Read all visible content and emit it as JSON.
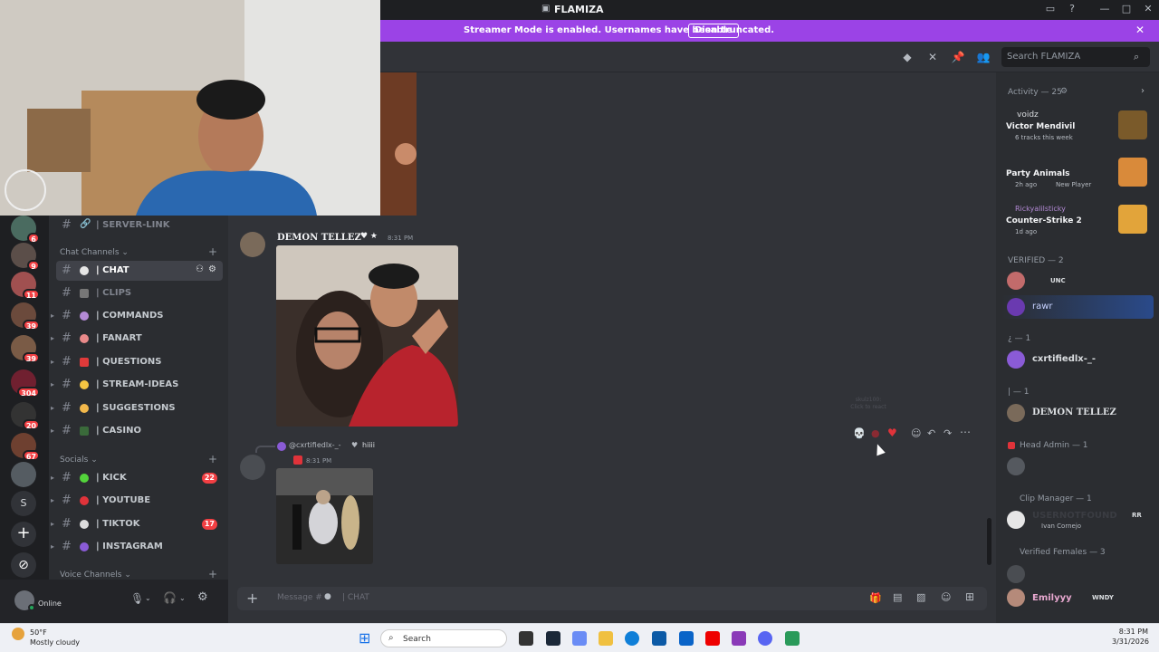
{
  "window": {
    "title": "FLAMIZA"
  },
  "banner": {
    "text": "Streamer Mode is enabled. Usernames have been truncated.",
    "button": "Disable"
  },
  "header": {
    "search_placeholder": "Search FLAMIZA"
  },
  "servers": [
    {
      "badge": "6"
    },
    {
      "badge": "9"
    },
    {
      "badge": "11"
    },
    {
      "badge": "39"
    },
    {
      "badge": "39"
    },
    {
      "badge": "304"
    },
    {
      "badge": "20"
    },
    {
      "badge": "67"
    },
    {
      "badge": ""
    },
    {
      "label": "S"
    }
  ],
  "channels": {
    "top_item": "| SERVER-LINK",
    "chat_category": "Chat Channels",
    "chat": [
      {
        "name": "| CHAT",
        "active": true
      },
      {
        "name": "| CLIPS"
      },
      {
        "name": "| COMMANDS"
      },
      {
        "name": "| FANART"
      },
      {
        "name": "| QUESTIONS"
      },
      {
        "name": "| STREAM-IDEAS"
      },
      {
        "name": "| SUGGESTIONS"
      },
      {
        "name": "| CASINO"
      }
    ],
    "socials_category": "Socials",
    "socials": [
      {
        "name": "| KICK",
        "count": "22"
      },
      {
        "name": "| YOUTUBE"
      },
      {
        "name": "| TIKTOK",
        "count": "17"
      },
      {
        "name": "| INSTAGRAM"
      }
    ],
    "voice_category": "Voice Channels"
  },
  "user_panel": {
    "status": "Online"
  },
  "messages": [
    {
      "author": "DEMON TELLEZ",
      "time": "8:31 PM"
    },
    {
      "reply_to": "@cxrtifiedlx-_-",
      "reply_text": "hiiii",
      "time": "8:31 PM"
    }
  ],
  "tooltip": {
    "line1": "skulz100:",
    "line2": "Click to react"
  },
  "composer": {
    "placeholder": "Message #",
    "channel": "| CHAT"
  },
  "members": {
    "activity_header": "Activity — 25",
    "activity": [
      {
        "user": "voidz",
        "title": "Victor Mendivil",
        "sub": "6 tracks this week"
      },
      {
        "user": "",
        "title": "Party Animals",
        "sub": "2h ago",
        "tag": "New Player"
      },
      {
        "user": "Rickyalilsticky",
        "title": "Counter-Strike 2",
        "sub": "1d ago"
      }
    ],
    "verified_header": "VERIFIED — 2",
    "verified": [
      {
        "name": "",
        "tag": "UNC"
      },
      {
        "name": "rawr"
      }
    ],
    "group1_header": "¿ — 1",
    "group1": [
      {
        "name": "cxrtifiedlx-_-"
      }
    ],
    "group2_header": "| — 1",
    "group2": [
      {
        "name": "DEMON TELLEZ"
      }
    ],
    "head_admin_header": "Head Admin — 1",
    "clip_manager_header": "Clip Manager — 1",
    "clip_manager": [
      {
        "name": "USERNOTFOUND",
        "tag": "RR",
        "sub": "Ivan Cornejo"
      }
    ],
    "verified_females_header": "Verified Females — 3",
    "verified_females": [
      {
        "name": "Emilyyy",
        "tag": "WNDY"
      }
    ]
  },
  "taskbar": {
    "weather_temp": "50°F",
    "weather_desc": "Mostly cloudy",
    "search": "Search",
    "time": "8:31 PM",
    "date": "3/31/2026"
  }
}
